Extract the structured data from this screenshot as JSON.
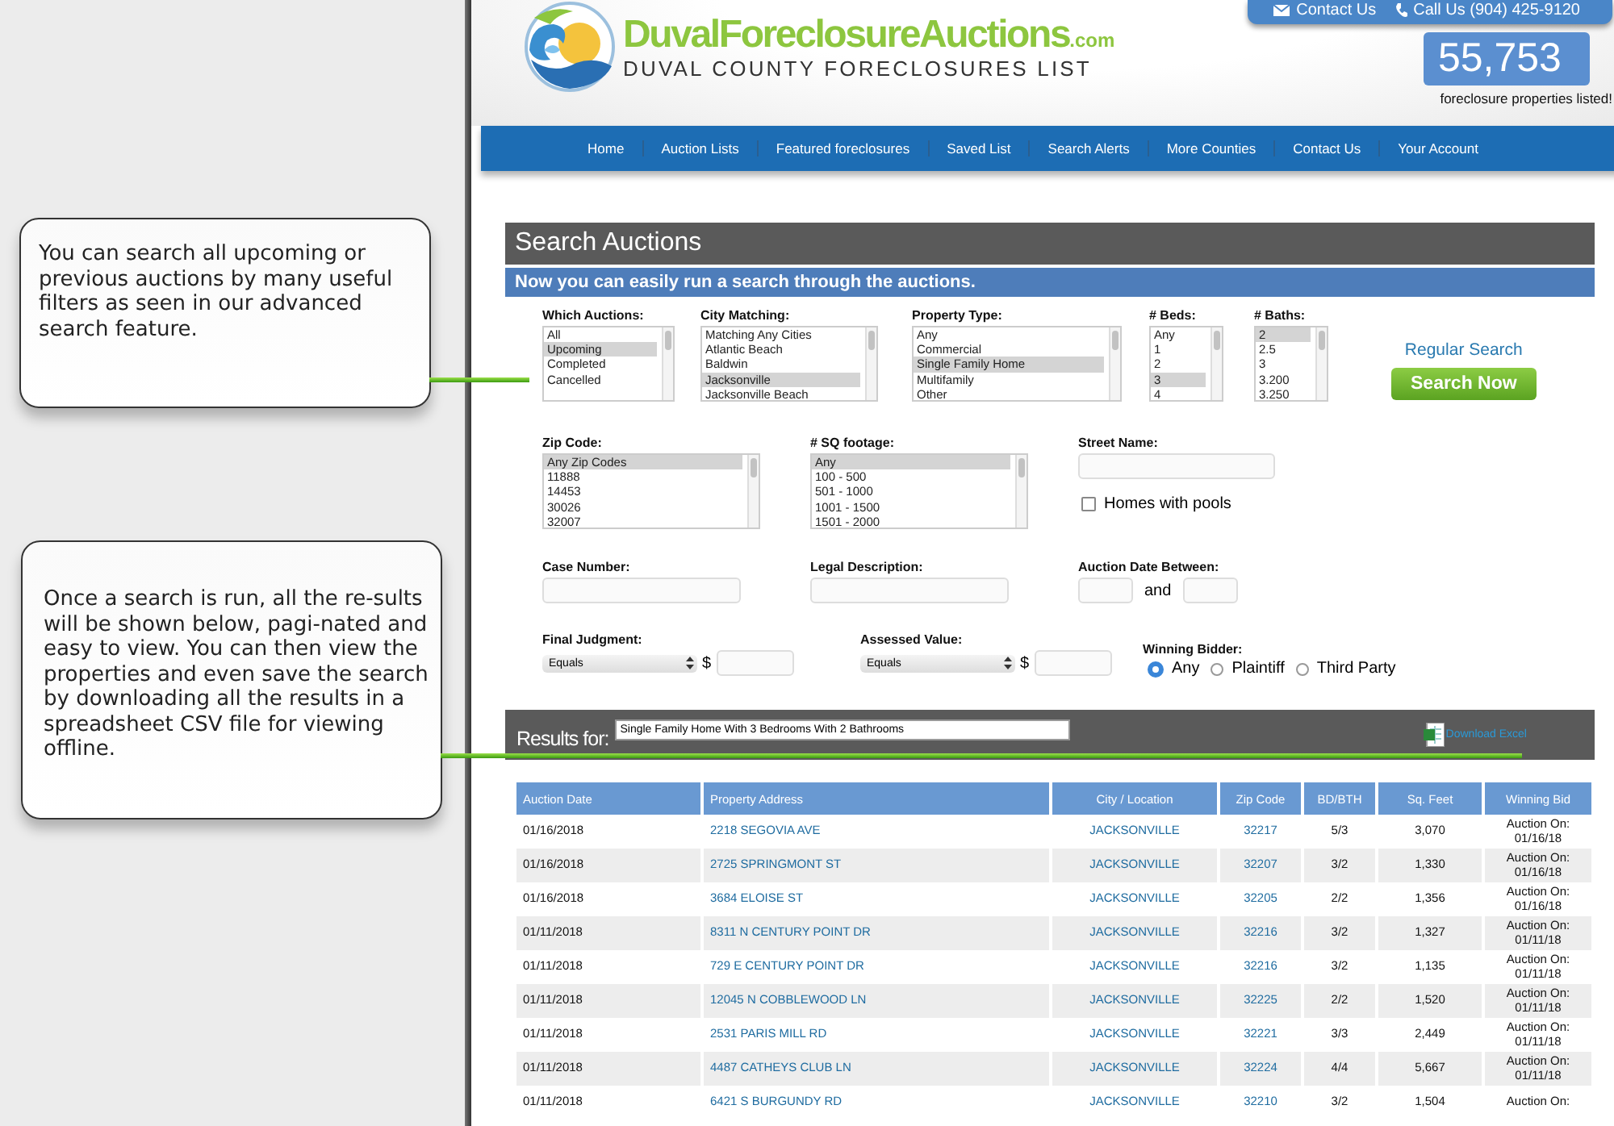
{
  "annotations": [
    {
      "text": "You can search all upcoming or previous auctions by many useful filters as seen in our advanced search feature."
    },
    {
      "text": "Once a search is run, all the re-sults will be shown below, pagi-nated and easy to view.  You can then view the properties and even save the search by downloading all the results in a spreadsheet CSV file for viewing offline."
    }
  ],
  "header": {
    "contact_link": "Contact Us",
    "phone_link": "Call Us (904) 425-9120",
    "brand": "DuvalForeclosureAuctions",
    "domain": ".com",
    "tagline": "DUVAL COUNTY FORECLOSURES LIST",
    "count": "55,753",
    "count_caption": "foreclosure properties listed!"
  },
  "nav": [
    {
      "label": "Home"
    },
    {
      "label": "Auction Lists"
    },
    {
      "label": "Featured foreclosures"
    },
    {
      "label": "Saved List"
    },
    {
      "label": "Search Alerts"
    },
    {
      "label": "More Counties"
    },
    {
      "label": "Contact Us"
    },
    {
      "label": "Your Account"
    }
  ],
  "search": {
    "title": "Search Auctions",
    "subtitle": "Now you can easily run a search through the auctions.",
    "lists": [
      {
        "label": "Which Auctions:",
        "options": [
          {
            "text": "All",
            "selected": false
          },
          {
            "text": "Upcoming",
            "selected": true
          },
          {
            "text": "Completed",
            "selected": false
          },
          {
            "text": "Cancelled",
            "selected": false
          }
        ]
      },
      {
        "label": "City Matching:",
        "options": [
          {
            "text": "Matching Any Cities",
            "selected": false
          },
          {
            "text": "Atlantic Beach",
            "selected": false
          },
          {
            "text": "Baldwin",
            "selected": false
          },
          {
            "text": "Jacksonville",
            "selected": true
          },
          {
            "text": "Jacksonville Beach",
            "selected": false
          }
        ]
      },
      {
        "label": "Property Type:",
        "options": [
          {
            "text": "Any",
            "selected": false
          },
          {
            "text": "Commercial",
            "selected": false
          },
          {
            "text": "Single Family Home",
            "selected": true
          },
          {
            "text": "Multifamily",
            "selected": false
          },
          {
            "text": "Other",
            "selected": false
          }
        ]
      },
      {
        "label": "# Beds:",
        "options": [
          {
            "text": "Any",
            "selected": false
          },
          {
            "text": "1",
            "selected": false
          },
          {
            "text": "2",
            "selected": false
          },
          {
            "text": "3",
            "selected": true
          },
          {
            "text": "4",
            "selected": false
          }
        ]
      },
      {
        "label": "# Baths:",
        "options": [
          {
            "text": "2",
            "selected": true
          },
          {
            "text": "2.5",
            "selected": false
          },
          {
            "text": "3",
            "selected": false
          },
          {
            "text": "3.200",
            "selected": false
          },
          {
            "text": "3.250",
            "selected": false
          }
        ]
      },
      {
        "label": "Zip Code:",
        "options": [
          {
            "text": "Any Zip Codes",
            "selected": true
          },
          {
            "text": "11888",
            "selected": false
          },
          {
            "text": "14453",
            "selected": false
          },
          {
            "text": "30026",
            "selected": false
          },
          {
            "text": "32007",
            "selected": false
          }
        ]
      },
      {
        "label": "# SQ footage:",
        "options": [
          {
            "text": "Any",
            "selected": true
          },
          {
            "text": "100 - 500",
            "selected": false
          },
          {
            "text": "501 - 1000",
            "selected": false
          },
          {
            "text": "1001 - 1500",
            "selected": false
          },
          {
            "text": "1501 - 2000",
            "selected": false
          }
        ]
      }
    ],
    "regular_search": "Regular Search",
    "search_button": "Search Now",
    "street_label": "Street Name:",
    "pools": {
      "label": "Homes with pools",
      "checked": false
    },
    "case_label": "Case Number:",
    "legal_label": "Legal Description:",
    "date_label": "Auction Date Between:",
    "date_and": "and",
    "final_judgment": {
      "label": "Final Judgment:",
      "operator": "Equals",
      "currency": "$"
    },
    "assessed_value": {
      "label": "Assessed Value:",
      "operator": "Equals",
      "currency": "$"
    },
    "winning_bidder": {
      "label": "Winning Bidder:",
      "options": [
        {
          "text": "Any",
          "selected": true
        },
        {
          "text": "Plaintiff",
          "selected": false
        },
        {
          "text": "Third Party",
          "selected": false
        }
      ]
    }
  },
  "results": {
    "label": "Results for:",
    "query": "Single Family Home With 3 Bedrooms With 2 Bathrooms",
    "download": "Download Excel",
    "columns": [
      "Auction Date",
      "Property Address",
      "City / Location",
      "Zip Code",
      "BD/BTH",
      "Sq. Feet",
      "Winning Bid"
    ],
    "rows": [
      {
        "date": "01/16/2018",
        "address": "2218 SEGOVIA AVE",
        "city": "JACKSONVILLE",
        "zip": "32217",
        "bd_bth": "5/3",
        "sq_feet": "3,070",
        "winning_bid": [
          "Auction On:",
          "01/16/18"
        ]
      },
      {
        "date": "01/16/2018",
        "address": "2725 SPRINGMONT ST",
        "city": "JACKSONVILLE",
        "zip": "32207",
        "bd_bth": "3/2",
        "sq_feet": "1,330",
        "winning_bid": [
          "Auction On:",
          "01/16/18"
        ]
      },
      {
        "date": "01/16/2018",
        "address": "3684 ELOISE ST",
        "city": "JACKSONVILLE",
        "zip": "32205",
        "bd_bth": "2/2",
        "sq_feet": "1,356",
        "winning_bid": [
          "Auction On:",
          "01/16/18"
        ]
      },
      {
        "date": "01/11/2018",
        "address": "8311 N CENTURY POINT DR",
        "city": "JACKSONVILLE",
        "zip": "32216",
        "bd_bth": "3/2",
        "sq_feet": "1,327",
        "winning_bid": [
          "Auction On:",
          "01/11/18"
        ]
      },
      {
        "date": "01/11/2018",
        "address": "729 E CENTURY POINT DR",
        "city": "JACKSONVILLE",
        "zip": "32216",
        "bd_bth": "3/2",
        "sq_feet": "1,135",
        "winning_bid": [
          "Auction On:",
          "01/11/18"
        ]
      },
      {
        "date": "01/11/2018",
        "address": "12045 N COBBLEWOOD LN",
        "city": "JACKSONVILLE",
        "zip": "32225",
        "bd_bth": "2/2",
        "sq_feet": "1,520",
        "winning_bid": [
          "Auction On:",
          "01/11/18"
        ]
      },
      {
        "date": "01/11/2018",
        "address": "2531 PARIS MILL RD",
        "city": "JACKSONVILLE",
        "zip": "32221",
        "bd_bth": "3/3",
        "sq_feet": "2,449",
        "winning_bid": [
          "Auction On:",
          "01/11/18"
        ]
      },
      {
        "date": "01/11/2018",
        "address": "4487 CATHEYS CLUB LN",
        "city": "JACKSONVILLE",
        "zip": "32224",
        "bd_bth": "4/4",
        "sq_feet": "5,667",
        "winning_bid": [
          "Auction On:",
          "01/11/18"
        ]
      },
      {
        "date": "01/11/2018",
        "address": "6421 S BURGUNDY RD",
        "city": "JACKSONVILLE",
        "zip": "32210",
        "bd_bth": "3/2",
        "sq_feet": "1,504",
        "winning_bid": [
          "Auction On:"
        ]
      }
    ]
  }
}
